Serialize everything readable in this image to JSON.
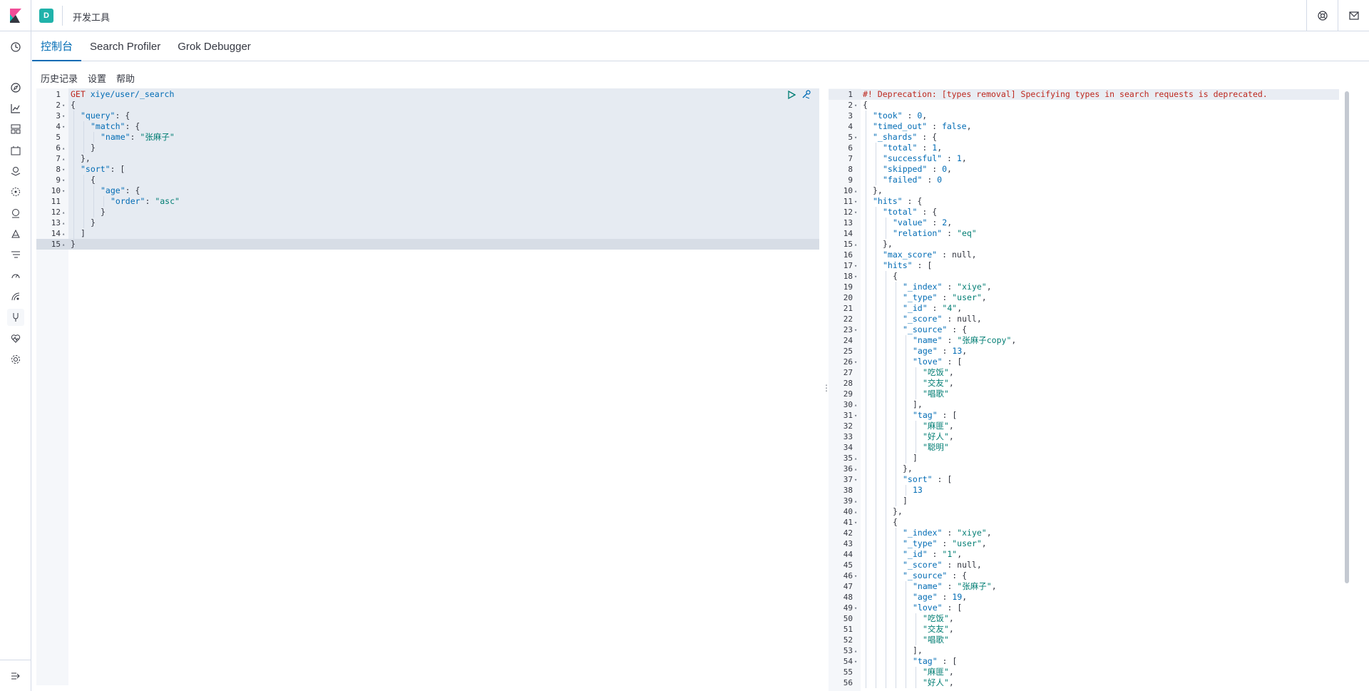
{
  "header": {
    "space_initial": "D",
    "app_title": "开发工具",
    "right_icons": [
      "help-icon",
      "mail-icon"
    ]
  },
  "sidenav": {
    "items": [
      "recent-icon",
      "discover-icon",
      "visualize-icon",
      "dashboard-icon",
      "canvas-icon",
      "maps-icon",
      "ml-icon",
      "metrics-icon",
      "logs-icon",
      "apm-icon",
      "uptime-icon",
      "siem-icon",
      "dev-tools-icon",
      "monitoring-icon",
      "management-icon"
    ],
    "active": "dev-tools-icon"
  },
  "tabs": [
    {
      "label": "控制台",
      "active": true
    },
    {
      "label": "Search Profiler",
      "active": false
    },
    {
      "label": "Grok Debugger",
      "active": false
    }
  ],
  "console_menu": [
    "历史记录",
    "设置",
    "帮助"
  ],
  "request": {
    "lines": [
      {
        "n": "1",
        "fold": "",
        "indent": 0,
        "parts": [
          [
            "method",
            "GET "
          ],
          [
            "url",
            "xiye/user/_search"
          ]
        ]
      },
      {
        "n": "2",
        "fold": "▾",
        "indent": 0,
        "parts": [
          [
            "k",
            "{"
          ]
        ]
      },
      {
        "n": "3",
        "fold": "▾",
        "indent": 1,
        "parts": [
          [
            "key",
            "\"query\""
          ],
          [
            "k",
            ": {"
          ]
        ]
      },
      {
        "n": "4",
        "fold": "▾",
        "indent": 2,
        "parts": [
          [
            "key",
            "\"match\""
          ],
          [
            "k",
            ": {"
          ]
        ]
      },
      {
        "n": "5",
        "fold": "",
        "indent": 3,
        "parts": [
          [
            "key",
            "\"name\""
          ],
          [
            "k",
            ": "
          ],
          [
            "str",
            "\"张麻子\""
          ]
        ]
      },
      {
        "n": "6",
        "fold": "▴",
        "indent": 2,
        "parts": [
          [
            "k",
            "}"
          ]
        ]
      },
      {
        "n": "7",
        "fold": "▴",
        "indent": 1,
        "parts": [
          [
            "k",
            "},"
          ]
        ]
      },
      {
        "n": "8",
        "fold": "▾",
        "indent": 1,
        "parts": [
          [
            "key",
            "\"sort\""
          ],
          [
            "k",
            ": ["
          ]
        ]
      },
      {
        "n": "9",
        "fold": "▾",
        "indent": 2,
        "parts": [
          [
            "k",
            "{"
          ]
        ]
      },
      {
        "n": "10",
        "fold": "▾",
        "indent": 3,
        "parts": [
          [
            "key",
            "\"age\""
          ],
          [
            "k",
            ": {"
          ]
        ]
      },
      {
        "n": "11",
        "fold": "",
        "indent": 4,
        "parts": [
          [
            "key",
            "\"order\""
          ],
          [
            "k",
            ": "
          ],
          [
            "str",
            "\"asc\""
          ]
        ]
      },
      {
        "n": "12",
        "fold": "▴",
        "indent": 3,
        "parts": [
          [
            "k",
            "}"
          ]
        ]
      },
      {
        "n": "13",
        "fold": "▴",
        "indent": 2,
        "parts": [
          [
            "k",
            "}"
          ]
        ]
      },
      {
        "n": "14",
        "fold": "▴",
        "indent": 1,
        "parts": [
          [
            "k",
            "]"
          ]
        ]
      },
      {
        "n": "15",
        "fold": "▴",
        "indent": 0,
        "parts": [
          [
            "k",
            "}"
          ]
        ]
      }
    ],
    "active_line": "15"
  },
  "response": {
    "lines": [
      {
        "n": "1",
        "fold": "",
        "indent": 0,
        "parts": [
          [
            "comment",
            "#! Deprecation: [types removal] Specifying types in search requests is deprecated."
          ]
        ]
      },
      {
        "n": "2",
        "fold": "▾",
        "indent": 0,
        "parts": [
          [
            "k",
            "{"
          ]
        ]
      },
      {
        "n": "3",
        "fold": "",
        "indent": 1,
        "parts": [
          [
            "key",
            "\"took\""
          ],
          [
            "k",
            " : "
          ],
          [
            "num",
            "0"
          ],
          [
            "k",
            ","
          ]
        ]
      },
      {
        "n": "4",
        "fold": "",
        "indent": 1,
        "parts": [
          [
            "key",
            "\"timed_out\""
          ],
          [
            "k",
            " : "
          ],
          [
            "kw",
            "false"
          ],
          [
            "k",
            ","
          ]
        ]
      },
      {
        "n": "5",
        "fold": "▾",
        "indent": 1,
        "parts": [
          [
            "key",
            "\"_shards\""
          ],
          [
            "k",
            " : {"
          ]
        ]
      },
      {
        "n": "6",
        "fold": "",
        "indent": 2,
        "parts": [
          [
            "key",
            "\"total\""
          ],
          [
            "k",
            " : "
          ],
          [
            "num",
            "1"
          ],
          [
            "k",
            ","
          ]
        ]
      },
      {
        "n": "7",
        "fold": "",
        "indent": 2,
        "parts": [
          [
            "key",
            "\"successful\""
          ],
          [
            "k",
            " : "
          ],
          [
            "num",
            "1"
          ],
          [
            "k",
            ","
          ]
        ]
      },
      {
        "n": "8",
        "fold": "",
        "indent": 2,
        "parts": [
          [
            "key",
            "\"skipped\""
          ],
          [
            "k",
            " : "
          ],
          [
            "num",
            "0"
          ],
          [
            "k",
            ","
          ]
        ]
      },
      {
        "n": "9",
        "fold": "",
        "indent": 2,
        "parts": [
          [
            "key",
            "\"failed\""
          ],
          [
            "k",
            " : "
          ],
          [
            "num",
            "0"
          ]
        ]
      },
      {
        "n": "10",
        "fold": "▴",
        "indent": 1,
        "parts": [
          [
            "k",
            "},"
          ]
        ]
      },
      {
        "n": "11",
        "fold": "▾",
        "indent": 1,
        "parts": [
          [
            "key",
            "\"hits\""
          ],
          [
            "k",
            " : {"
          ]
        ]
      },
      {
        "n": "12",
        "fold": "▾",
        "indent": 2,
        "parts": [
          [
            "key",
            "\"total\""
          ],
          [
            "k",
            " : {"
          ]
        ]
      },
      {
        "n": "13",
        "fold": "",
        "indent": 3,
        "parts": [
          [
            "key",
            "\"value\""
          ],
          [
            "k",
            " : "
          ],
          [
            "num",
            "2"
          ],
          [
            "k",
            ","
          ]
        ]
      },
      {
        "n": "14",
        "fold": "",
        "indent": 3,
        "parts": [
          [
            "key",
            "\"relation\""
          ],
          [
            "k",
            " : "
          ],
          [
            "str",
            "\"eq\""
          ]
        ]
      },
      {
        "n": "15",
        "fold": "▴",
        "indent": 2,
        "parts": [
          [
            "k",
            "},"
          ]
        ]
      },
      {
        "n": "16",
        "fold": "",
        "indent": 2,
        "parts": [
          [
            "key",
            "\"max_score\""
          ],
          [
            "k",
            " : null,"
          ]
        ]
      },
      {
        "n": "17",
        "fold": "▾",
        "indent": 2,
        "parts": [
          [
            "key",
            "\"hits\""
          ],
          [
            "k",
            " : ["
          ]
        ]
      },
      {
        "n": "18",
        "fold": "▾",
        "indent": 3,
        "parts": [
          [
            "k",
            "{"
          ]
        ]
      },
      {
        "n": "19",
        "fold": "",
        "indent": 4,
        "parts": [
          [
            "key",
            "\"_index\""
          ],
          [
            "k",
            " : "
          ],
          [
            "str",
            "\"xiye\""
          ],
          [
            "k",
            ","
          ]
        ]
      },
      {
        "n": "20",
        "fold": "",
        "indent": 4,
        "parts": [
          [
            "key",
            "\"_type\""
          ],
          [
            "k",
            " : "
          ],
          [
            "str",
            "\"user\""
          ],
          [
            "k",
            ","
          ]
        ]
      },
      {
        "n": "21",
        "fold": "",
        "indent": 4,
        "parts": [
          [
            "key",
            "\"_id\""
          ],
          [
            "k",
            " : "
          ],
          [
            "str",
            "\"4\""
          ],
          [
            "k",
            ","
          ]
        ]
      },
      {
        "n": "22",
        "fold": "",
        "indent": 4,
        "parts": [
          [
            "key",
            "\"_score\""
          ],
          [
            "k",
            " : null,"
          ]
        ]
      },
      {
        "n": "23",
        "fold": "▾",
        "indent": 4,
        "parts": [
          [
            "key",
            "\"_source\""
          ],
          [
            "k",
            " : {"
          ]
        ]
      },
      {
        "n": "24",
        "fold": "",
        "indent": 5,
        "parts": [
          [
            "key",
            "\"name\""
          ],
          [
            "k",
            " : "
          ],
          [
            "str",
            "\"张麻子copy\""
          ],
          [
            "k",
            ","
          ]
        ]
      },
      {
        "n": "25",
        "fold": "",
        "indent": 5,
        "parts": [
          [
            "key",
            "\"age\""
          ],
          [
            "k",
            " : "
          ],
          [
            "num",
            "13"
          ],
          [
            "k",
            ","
          ]
        ]
      },
      {
        "n": "26",
        "fold": "▾",
        "indent": 5,
        "parts": [
          [
            "key",
            "\"love\""
          ],
          [
            "k",
            " : ["
          ]
        ]
      },
      {
        "n": "27",
        "fold": "",
        "indent": 6,
        "parts": [
          [
            "str",
            "\"吃饭\""
          ],
          [
            "k",
            ","
          ]
        ]
      },
      {
        "n": "28",
        "fold": "",
        "indent": 6,
        "parts": [
          [
            "str",
            "\"交友\""
          ],
          [
            "k",
            ","
          ]
        ]
      },
      {
        "n": "29",
        "fold": "",
        "indent": 6,
        "parts": [
          [
            "str",
            "\"唱歌\""
          ]
        ]
      },
      {
        "n": "30",
        "fold": "▴",
        "indent": 5,
        "parts": [
          [
            "k",
            "],"
          ]
        ]
      },
      {
        "n": "31",
        "fold": "▾",
        "indent": 5,
        "parts": [
          [
            "key",
            "\"tag\""
          ],
          [
            "k",
            " : ["
          ]
        ]
      },
      {
        "n": "32",
        "fold": "",
        "indent": 6,
        "parts": [
          [
            "str",
            "\"麻匪\""
          ],
          [
            "k",
            ","
          ]
        ]
      },
      {
        "n": "33",
        "fold": "",
        "indent": 6,
        "parts": [
          [
            "str",
            "\"好人\""
          ],
          [
            "k",
            ","
          ]
        ]
      },
      {
        "n": "34",
        "fold": "",
        "indent": 6,
        "parts": [
          [
            "str",
            "\"聪明\""
          ]
        ]
      },
      {
        "n": "35",
        "fold": "▴",
        "indent": 5,
        "parts": [
          [
            "k",
            "]"
          ]
        ]
      },
      {
        "n": "36",
        "fold": "▴",
        "indent": 4,
        "parts": [
          [
            "k",
            "},"
          ]
        ]
      },
      {
        "n": "37",
        "fold": "▾",
        "indent": 4,
        "parts": [
          [
            "key",
            "\"sort\""
          ],
          [
            "k",
            " : ["
          ]
        ]
      },
      {
        "n": "38",
        "fold": "",
        "indent": 5,
        "parts": [
          [
            "num",
            "13"
          ]
        ]
      },
      {
        "n": "39",
        "fold": "▴",
        "indent": 4,
        "parts": [
          [
            "k",
            "]"
          ]
        ]
      },
      {
        "n": "40",
        "fold": "▴",
        "indent": 3,
        "parts": [
          [
            "k",
            "},"
          ]
        ]
      },
      {
        "n": "41",
        "fold": "▾",
        "indent": 3,
        "parts": [
          [
            "k",
            "{"
          ]
        ]
      },
      {
        "n": "42",
        "fold": "",
        "indent": 4,
        "parts": [
          [
            "key",
            "\"_index\""
          ],
          [
            "k",
            " : "
          ],
          [
            "str",
            "\"xiye\""
          ],
          [
            "k",
            ","
          ]
        ]
      },
      {
        "n": "43",
        "fold": "",
        "indent": 4,
        "parts": [
          [
            "key",
            "\"_type\""
          ],
          [
            "k",
            " : "
          ],
          [
            "str",
            "\"user\""
          ],
          [
            "k",
            ","
          ]
        ]
      },
      {
        "n": "44",
        "fold": "",
        "indent": 4,
        "parts": [
          [
            "key",
            "\"_id\""
          ],
          [
            "k",
            " : "
          ],
          [
            "str",
            "\"1\""
          ],
          [
            "k",
            ","
          ]
        ]
      },
      {
        "n": "45",
        "fold": "",
        "indent": 4,
        "parts": [
          [
            "key",
            "\"_score\""
          ],
          [
            "k",
            " : null,"
          ]
        ]
      },
      {
        "n": "46",
        "fold": "▾",
        "indent": 4,
        "parts": [
          [
            "key",
            "\"_source\""
          ],
          [
            "k",
            " : {"
          ]
        ]
      },
      {
        "n": "47",
        "fold": "",
        "indent": 5,
        "parts": [
          [
            "key",
            "\"name\""
          ],
          [
            "k",
            " : "
          ],
          [
            "str",
            "\"张麻子\""
          ],
          [
            "k",
            ","
          ]
        ]
      },
      {
        "n": "48",
        "fold": "",
        "indent": 5,
        "parts": [
          [
            "key",
            "\"age\""
          ],
          [
            "k",
            " : "
          ],
          [
            "num",
            "19"
          ],
          [
            "k",
            ","
          ]
        ]
      },
      {
        "n": "49",
        "fold": "▾",
        "indent": 5,
        "parts": [
          [
            "key",
            "\"love\""
          ],
          [
            "k",
            " : ["
          ]
        ]
      },
      {
        "n": "50",
        "fold": "",
        "indent": 6,
        "parts": [
          [
            "str",
            "\"吃饭\""
          ],
          [
            "k",
            ","
          ]
        ]
      },
      {
        "n": "51",
        "fold": "",
        "indent": 6,
        "parts": [
          [
            "str",
            "\"交友\""
          ],
          [
            "k",
            ","
          ]
        ]
      },
      {
        "n": "52",
        "fold": "",
        "indent": 6,
        "parts": [
          [
            "str",
            "\"唱歌\""
          ]
        ]
      },
      {
        "n": "53",
        "fold": "▴",
        "indent": 5,
        "parts": [
          [
            "k",
            "],"
          ]
        ]
      },
      {
        "n": "54",
        "fold": "▾",
        "indent": 5,
        "parts": [
          [
            "key",
            "\"tag\""
          ],
          [
            "k",
            " : ["
          ]
        ]
      },
      {
        "n": "55",
        "fold": "",
        "indent": 6,
        "parts": [
          [
            "str",
            "\"麻匪\""
          ],
          [
            "k",
            ","
          ]
        ]
      },
      {
        "n": "56",
        "fold": "",
        "indent": 6,
        "parts": [
          [
            "str",
            "\"好人\""
          ],
          [
            "k",
            ","
          ]
        ]
      }
    ]
  }
}
